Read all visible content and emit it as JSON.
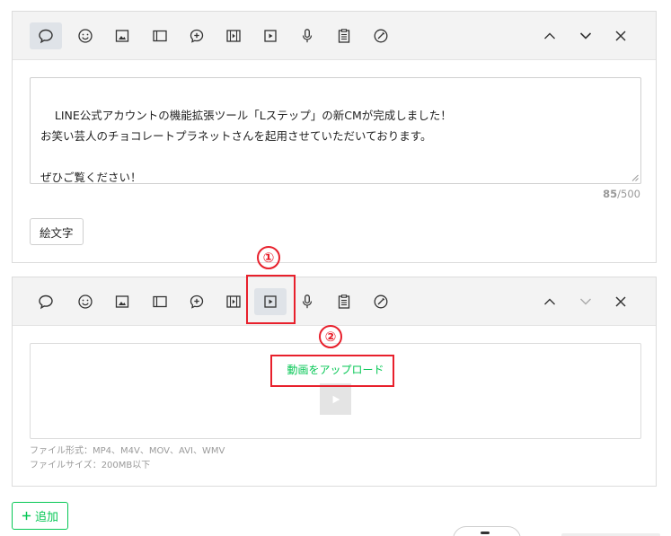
{
  "message_card": {
    "text": "LINE公式アカウントの機能拡張ツール「Lステップ」の新CMが完成しました！\nお笑い芸人のチョコレートプラネットさんを起用させていただいております。\n\nぜひご覧ください！",
    "char_count": "85",
    "char_limit": "/500",
    "emoji_button": "絵文字"
  },
  "video_card": {
    "upload_link": "動画をアップロード",
    "note_formats": "ファイル形式：MP4、M4V、MOV、AVI、WMV",
    "note_size": "ファイルサイズ：200MB以下"
  },
  "add_button": "追加",
  "add_icon": "plus-icon",
  "annotations": {
    "step1": "①",
    "step2": "②"
  },
  "toolbar_icons": [
    "speech-bubble-icon",
    "smiley-icon",
    "image-icon",
    "card-icon",
    "chat-plus-icon",
    "film-icon",
    "video-play-icon",
    "microphone-icon",
    "clipboard-icon",
    "stamp-icon"
  ],
  "colors": {
    "accent": "#06c755",
    "annotation_red": "#e8202c",
    "toolbar_bg": "#f3f3f3",
    "active_icon_bg": "#dfe3e8"
  }
}
